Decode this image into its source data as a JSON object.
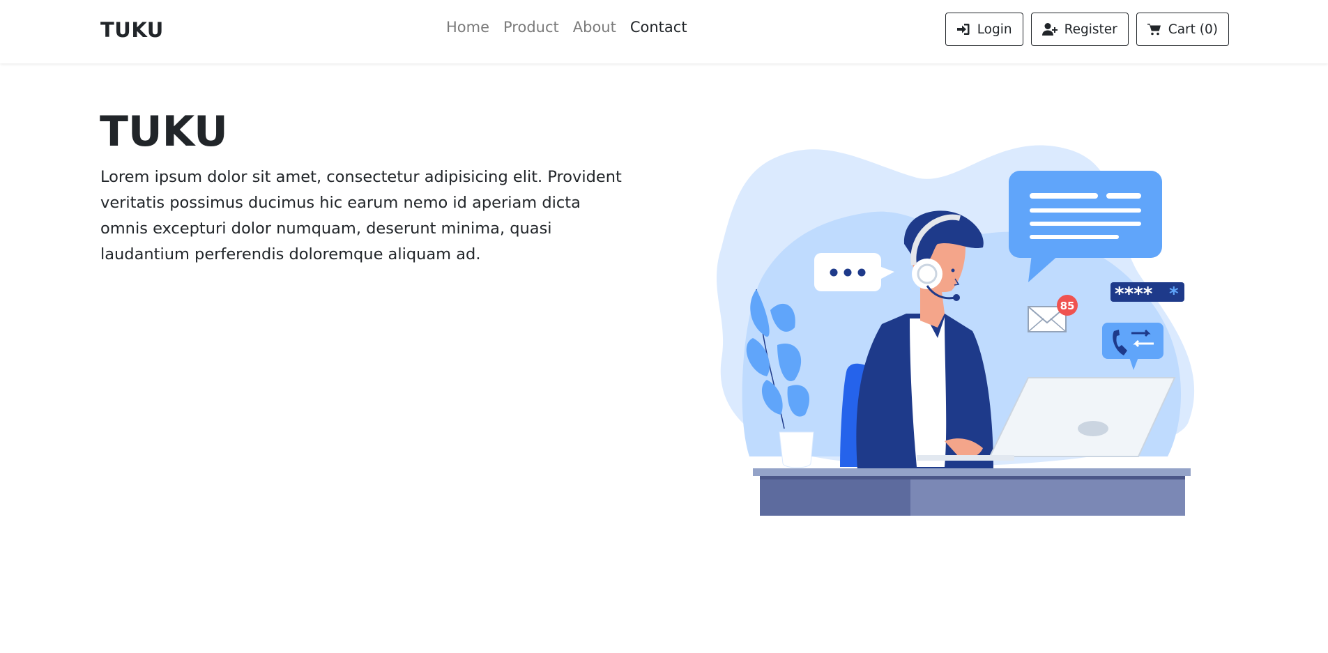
{
  "navbar": {
    "brand": "TUKU",
    "links": [
      {
        "label": "Home",
        "active": false
      },
      {
        "label": "Product",
        "active": false
      },
      {
        "label": "About",
        "active": false
      },
      {
        "label": "Contact",
        "active": true
      }
    ],
    "buttons": {
      "login": {
        "label": "Login",
        "icon": "sign-in-icon"
      },
      "register": {
        "label": "Register",
        "icon": "user-plus-icon"
      },
      "cart": {
        "label": "Cart (0)",
        "icon": "shopping-cart-icon"
      }
    }
  },
  "hero": {
    "title": "TUKU",
    "text": "Lorem ipsum dolor sit amet, consectetur adipisicing elit. Provident veritatis possimus ducimus hic earum nemo id aperiam dicta omnis excepturi dolor numquam, deserunt minima, quasi laudantium perferendis doloremque aliquam ad.",
    "illustration": {
      "description_icon": "customer-support-agent-illustration",
      "notification_count": "85",
      "password_mask": "****",
      "colors": {
        "blob_light": "#dbeafe",
        "blob_mid": "#bfdbfe",
        "accent_blue": "#60a5fa",
        "navy": "#1e3a8a",
        "desk": "#7b88b5",
        "badge": "#ef5350"
      }
    }
  }
}
